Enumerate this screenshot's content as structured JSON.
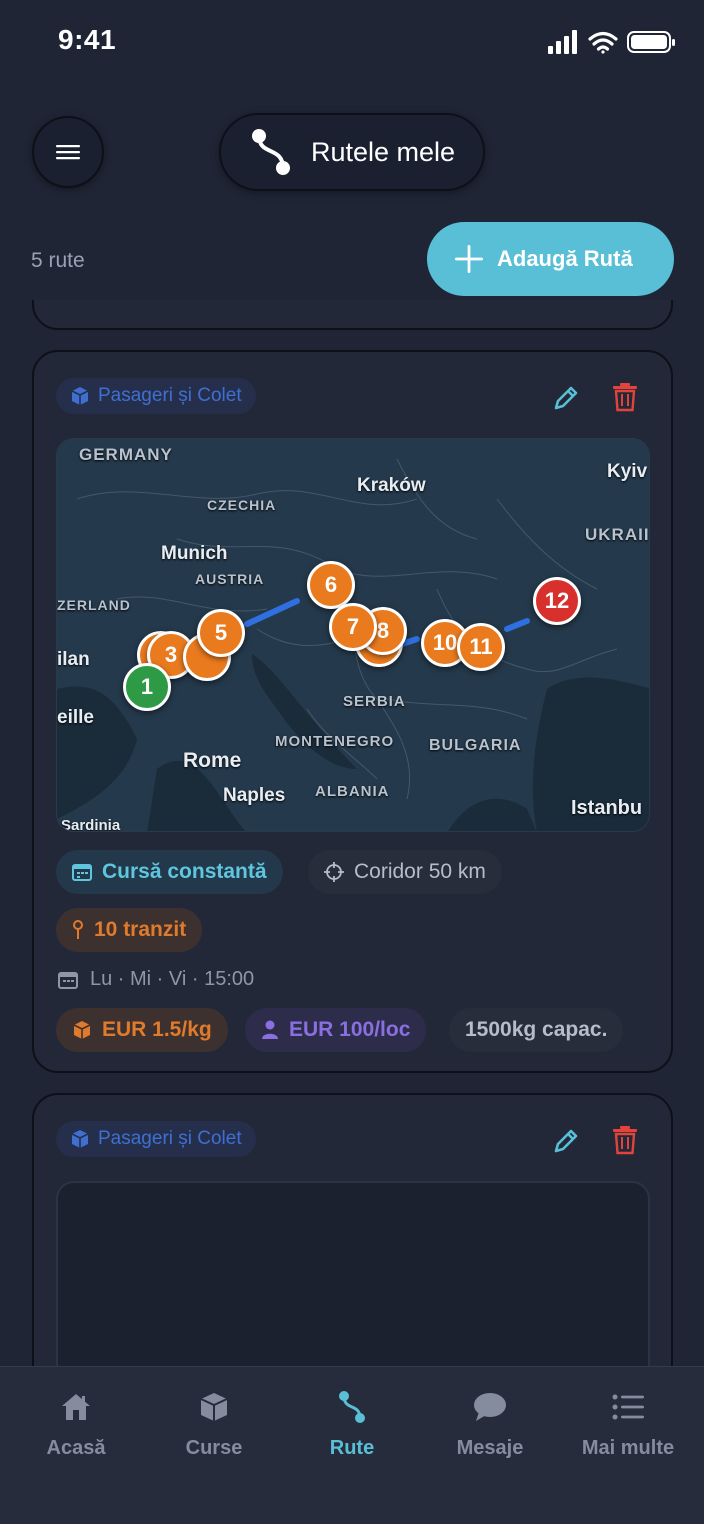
{
  "status_bar": {
    "time": "9:41"
  },
  "header": {
    "title": "Rutele mele"
  },
  "toolbar": {
    "route_count": "5 rute",
    "add_label": "Adaugă Rută"
  },
  "cards": [
    {
      "type_label": "Pasageri și Colet",
      "map": {
        "countries": [
          "GERMANY",
          "CZECHIA",
          "AUSTRIA",
          "ZERLAND",
          "SERBIA",
          "MONTENEGRO",
          "BULGARIA",
          "ALBANIA",
          "UKRAII"
        ],
        "cities": [
          "Kraków",
          "Munich",
          "Rome",
          "Naples",
          "Kyiv",
          "Istanbu",
          "ilan",
          "eille",
          "Sardinia"
        ],
        "markers": [
          "1",
          "3",
          "5",
          "6",
          "7",
          "8",
          "10",
          "11",
          "12"
        ]
      },
      "chips": {
        "constant": "Cursă constantă",
        "corridor": "Coridor 50 km",
        "transit": "10 tranzit",
        "schedule": "Lu · Mi · Vi · 15:00",
        "price_kg": "EUR 1.5/kg",
        "price_seat": "EUR 100/loc",
        "capacity": "1500kg capac."
      }
    },
    {
      "type_label": "Pasageri și Colet"
    }
  ],
  "nav": {
    "items": [
      "Acasă",
      "Curse",
      "Rute",
      "Mesaje",
      "Mai multe"
    ],
    "active": "Rute"
  },
  "colors": {
    "accent": "#58bfd6",
    "orange": "#ea7a1e",
    "purple": "#8a6fe0",
    "danger": "#e0443c",
    "background": "#1f2535"
  }
}
